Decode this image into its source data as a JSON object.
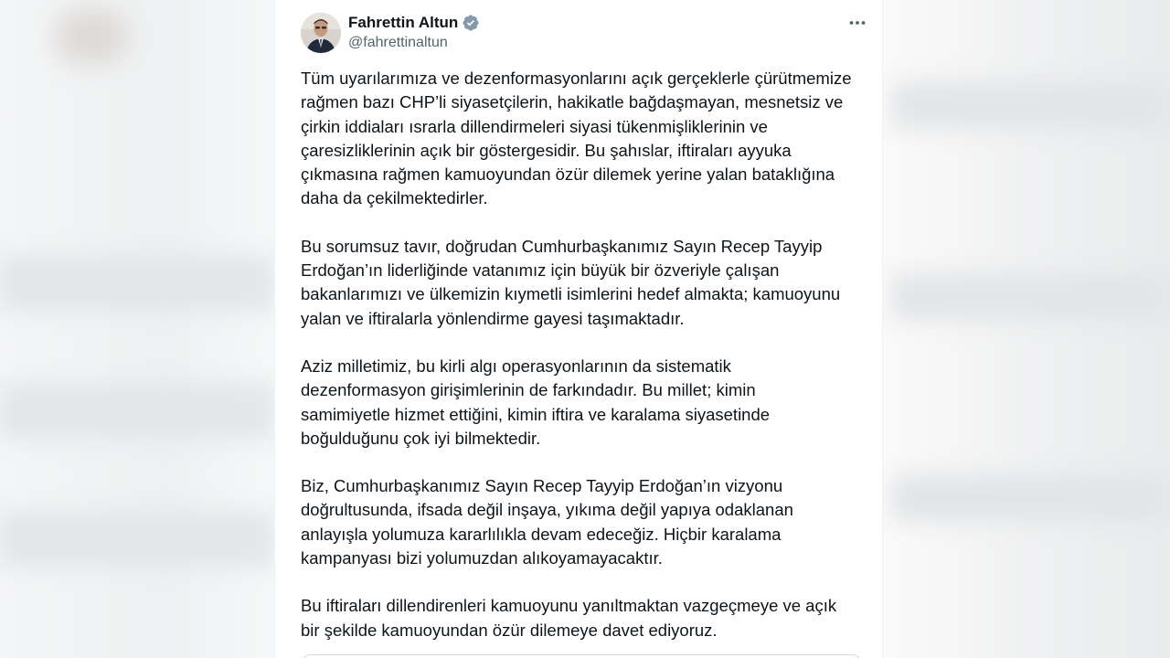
{
  "author": {
    "display_name": "Fahrettin Altun",
    "handle": "@fahrettinaltun",
    "verified_icon": "verified-badge-icon",
    "avatar_icon": "profile-photo",
    "more_icon": "more-options-icon"
  },
  "tweet": {
    "paragraphs": [
      "Tüm uyarılarımıza ve dezenformasyonlarını açık gerçeklerle çürütmemize\nrağmen bazı CHP’li siyasetçilerin, hakikatle bağdaşmayan, mesnetsiz ve\nçirkin iddiaları ısrarla dillendirmeleri siyasi tükenmişliklerinin ve\nçaresizliklerinin açık bir göstergesidir. Bu şahıslar, iftiraları ayyuka\nçıkmasına rağmen kamuoyundan özür dilemek yerine yalan bataklığına\ndaha da çekilmektedirler.",
      "Bu sorumsuz tavır, doğrudan Cumhurbaşkanımız Sayın Recep Tayyip\nErdoğan’ın liderliğinde vatanımız için büyük bir özveriyle çalışan\nbakanlarımızı ve ülkemizin kıymetli isimlerini hedef almakta; kamuoyunu\nyalan ve iftiralarla yönlendirme gayesi taşımaktadır.",
      "Aziz milletimiz, bu kirli algı operasyonlarının da sistematik\ndezenformasyon girişimlerinin de farkındadır. Bu millet; kimin\nsamimiyetle hizmet ettiğini, kimin iftira ve karalama siyasetinde\nboğulduğunu çok iyi bilmektedir.",
      "Biz, Cumhurbaşkanımız Sayın Recep Tayyip Erdoğan’ın vizyonu\ndoğrultusunda, ifsada değil inşaya, yıkıma değil yapıya odaklanan\nanlayışla yolumuza kararlılıkla devam edeceğiz. Hiçbir karalama\nkampanyası bizi yolumuzdan alıkoyamayacaktır.",
      "Bu iftiraları dillendirenleri kamuoyunu yanıltmaktan vazgeçmeye ve açık\nbir şekilde kamuoyundan özür dilemeye davet ediyoruz."
    ]
  },
  "colors": {
    "text": "#0f1419",
    "secondary_text": "#536471",
    "verified": "#829aab"
  }
}
